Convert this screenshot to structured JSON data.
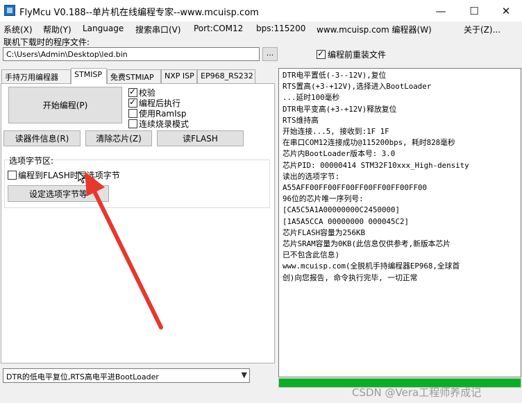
{
  "window": {
    "title": "FlyMcu V0.188--单片机在线编程专家--www.mcuisp.com",
    "icon": "flymcu-app-icon",
    "controls": {
      "minimize": "—",
      "maximize": "☐",
      "close": "✕"
    }
  },
  "menu": [
    {
      "label": "系统(X)"
    },
    {
      "label": "帮助(Y)"
    },
    {
      "label": "Language"
    },
    {
      "label": "搜索串口(V)"
    },
    {
      "label": "Port:COM12"
    },
    {
      "label": "bps:115200"
    },
    {
      "label": "www.mcuisp.com 编程器(W)"
    },
    {
      "label": "关于(Z)..."
    }
  ],
  "file": {
    "label": "联机下载时的程序文件:",
    "path": "C:\\Users\\Admin\\Desktop\\led.bin",
    "browse_label": "...",
    "reload_label": "编程前重装文件",
    "reload_checked": true
  },
  "tabs": [
    {
      "label": "手持万用编程器",
      "active": false
    },
    {
      "label": "STMISP",
      "active": true
    },
    {
      "label": "免费STMIAP",
      "active": false
    },
    {
      "label": "NXP ISP",
      "active": false
    },
    {
      "label": "EP968_RS232",
      "active": false
    }
  ],
  "stmisp": {
    "start_button": "开始编程(P)",
    "options": [
      {
        "label": "校验",
        "checked": true
      },
      {
        "label": "编程后执行",
        "checked": true
      },
      {
        "label": "使用RamIsp",
        "checked": false
      },
      {
        "label": "连续烧录模式",
        "checked": false
      }
    ],
    "read_info_button": "读器件信息(R)",
    "erase_button": "清除芯片(Z)",
    "read_flash_button": "读FLASH",
    "option_section_label": "选项字节区:",
    "flash_option_label": "编程到FLASH时写选项字节",
    "flash_option_checked": false,
    "set_option_button": "设定选项字节等"
  },
  "bottom_select": {
    "value": "DTR的低电平复位,RTS高电平进BootLoader",
    "arrow": "▼"
  },
  "log": [
    "DTR电平置低(-3--12V),复位",
    "RTS置高(+3-+12V),选择进入BootLoader",
    "...延时100毫秒",
    "DTR电平变高(+3-+12V)释放复位",
    "RTS维持高",
    "开始连接...5, 接收到:1F 1F",
    "在串口COM12连接成功@115200bps, 耗时828毫秒",
    "芯片内BootLoader版本号: 3.0",
    "芯片PID: 00000414  STM32F10xxx_High-density",
    "读出的选项字节:",
    "A55AFF00FF00FF00FF00FF00FF00FF00",
    "96位的芯片唯一序列号:",
    "[CA5C5A1A00000000C2450000]",
    "[1A5A5CCA 00000000 000045C2]",
    "芯片FLASH容量为256KB",
    "芯片SRAM容量为0KB(此信息仅供参考,新版本芯片",
    "已不包含此信息)",
    "www.mcuisp.com(全脱机手持编程器EP968,全球首",
    "创)向您报告, 命令执行完毕, 一切正常"
  ],
  "progress": {
    "fraction": 1.0,
    "color": "#06b025"
  },
  "annotation": {
    "arrow_color": "#e8372c"
  },
  "watermark": "CSDN @Vera工程师养成记"
}
